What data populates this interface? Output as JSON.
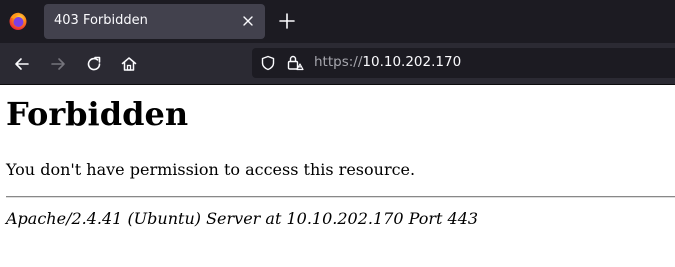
{
  "browser": {
    "tab": {
      "title": "403 Forbidden"
    },
    "address_bar": {
      "scheme": "https://",
      "host": "10.10.202.170"
    },
    "icons": {
      "browser_logo": "firefox-icon",
      "tab_close": "close-icon",
      "new_tab": "plus-icon",
      "back": "back-arrow-icon",
      "forward": "forward-arrow-icon",
      "reload": "reload-icon",
      "home": "home-icon",
      "tracking_protection": "shield-icon",
      "connection": "lock-warning-icon"
    },
    "forward_enabled": false
  },
  "page": {
    "heading": "Forbidden",
    "message": "You don't have permission to access this resource.",
    "server_signature": "Apache/2.4.41 (Ubuntu) Server at 10.10.202.170 Port 443"
  },
  "colors": {
    "tabbar_bg": "#1c1b22",
    "active_tab_bg": "#42414d",
    "navbar_bg": "#2b2a33",
    "urlbar_bg": "#1c1b22",
    "page_bg": "#ffffff"
  }
}
